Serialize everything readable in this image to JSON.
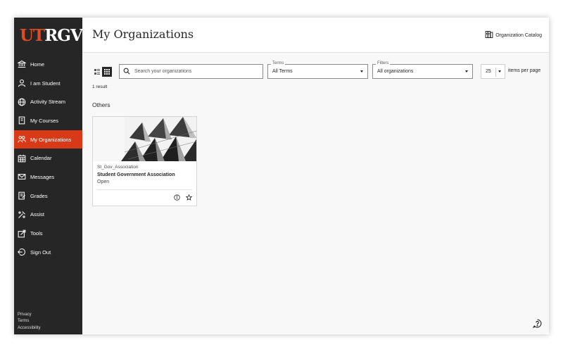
{
  "logo": {
    "ut": "UT",
    "rgv": "RGV",
    "tm": "®"
  },
  "sidebar": {
    "items": [
      {
        "label": "Home",
        "icon": "institution-icon",
        "active": false
      },
      {
        "label": "I am Student",
        "icon": "user-icon",
        "active": false
      },
      {
        "label": "Activity Stream",
        "icon": "globe-icon",
        "active": false
      },
      {
        "label": "My Courses",
        "icon": "courses-icon",
        "active": false
      },
      {
        "label": "My Organizations",
        "icon": "organizations-icon",
        "active": true
      },
      {
        "label": "Calendar",
        "icon": "calendar-icon",
        "active": false
      },
      {
        "label": "Messages",
        "icon": "envelope-icon",
        "active": false
      },
      {
        "label": "Grades",
        "icon": "grades-icon",
        "active": false
      },
      {
        "label": "Assist",
        "icon": "assist-icon",
        "active": false
      },
      {
        "label": "Tools",
        "icon": "tools-icon",
        "active": false
      },
      {
        "label": "Sign Out",
        "icon": "sign-out-icon",
        "active": false
      }
    ],
    "footer": {
      "privacy": "Privacy",
      "terms": "Terms",
      "accessibility": "Accessibility"
    }
  },
  "header": {
    "title": "My Organizations",
    "catalog_label": "Organization Catalog"
  },
  "toolbar": {
    "search_placeholder": "Search your organizations",
    "terms_label": "Terms",
    "terms_value": "All Terms",
    "filters_label": "Filters",
    "filters_value": "All organizations",
    "per_page_value": "25",
    "per_page_label": "items per page"
  },
  "results": {
    "count": "1 result",
    "section": "Others"
  },
  "card": {
    "code": "St_Gov_Association",
    "name": "Student Government Association",
    "status": "Open"
  },
  "colors": {
    "accent": "#d83a17",
    "sidebar": "#262626",
    "brand_red": "#e04a1e"
  }
}
